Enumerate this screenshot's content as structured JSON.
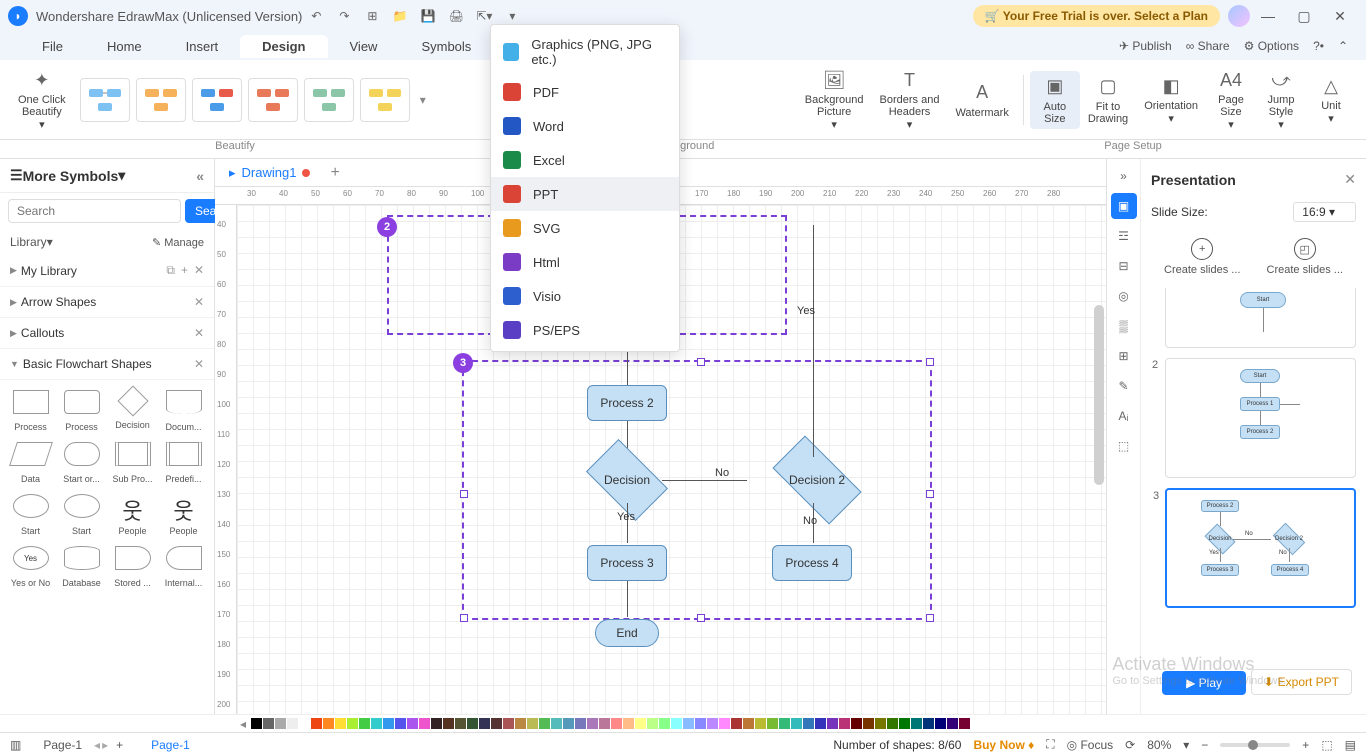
{
  "titlebar": {
    "app_name": "Wondershare EdrawMax (Unlicensed Version)",
    "trial": "🛒 Your Free Trial is over. Select a Plan"
  },
  "menu": {
    "items": [
      "File",
      "Home",
      "Insert",
      "Design",
      "View",
      "Symbols"
    ],
    "active": "Design",
    "right": {
      "publish": "Publish",
      "share": "Share",
      "options": "Options"
    }
  },
  "ribbon": {
    "one_click": "One Click\nBeautify",
    "beautify_label": "Beautify",
    "background_label": "Background",
    "pagesetup_label": "Page Setup",
    "btns": {
      "bgpic": "Background\nPicture",
      "borders": "Borders and\nHeaders",
      "watermark": "Watermark",
      "autosize": "Auto\nSize",
      "fit": "Fit to\nDrawing",
      "orient": "Orientation",
      "pagesize": "Page\nSize",
      "jump": "Jump\nStyle",
      "unit": "Unit"
    }
  },
  "export_menu": [
    {
      "label": "Graphics (PNG, JPG etc.)",
      "color": "#43b0e8"
    },
    {
      "label": "PDF",
      "color": "#d94436"
    },
    {
      "label": "Word",
      "color": "#2257c4"
    },
    {
      "label": "Excel",
      "color": "#1b8b4a"
    },
    {
      "label": "PPT",
      "color": "#d94436",
      "hover": true
    },
    {
      "label": "SVG",
      "color": "#e89a1f"
    },
    {
      "label": "Html",
      "color": "#7a3cc4"
    },
    {
      "label": "Visio",
      "color": "#2e5fcf"
    },
    {
      "label": "PS/EPS",
      "color": "#5a3fc4"
    }
  ],
  "sidebar": {
    "title": "More Symbols",
    "search_placeholder": "Search",
    "search_btn": "Search",
    "library": "Library",
    "manage": "✎ Manage",
    "mylib": "My Library",
    "cats": [
      "Arrow Shapes",
      "Callouts",
      "Basic Flowchart Shapes"
    ],
    "shapes": [
      "Process",
      "Process",
      "Decision",
      "Docum...",
      "Data",
      "Start or...",
      "Sub Pro...",
      "Predefi...",
      "Start",
      "Start",
      "People",
      "People",
      "Yes or No",
      "Database",
      "Stored ...",
      "Internal..."
    ]
  },
  "doc_tab": "Drawing1",
  "canvas": {
    "nodes": {
      "process2": "Process 2",
      "decision": "Decision",
      "decision2": "Decision 2",
      "process3": "Process 3",
      "process4": "Process 4",
      "end": "End"
    },
    "labels": {
      "yes": "Yes",
      "no": "No"
    },
    "badges": [
      "2",
      "3"
    ]
  },
  "rpanel": {
    "title": "Presentation",
    "slide_size_label": "Slide Size:",
    "slide_size_value": "16:9",
    "create1": "Create slides ...",
    "create2": "Create slides ...",
    "thumbs": [
      {
        "num": "",
        "items": [
          "Start"
        ],
        "sel": false,
        "partial": true
      },
      {
        "num": "2",
        "items": [
          "Start",
          "Process 1",
          "Process 2"
        ],
        "sel": false
      },
      {
        "num": "3",
        "items": [
          "Process 2",
          "Decision",
          "Decision 2",
          "Process 3",
          "Process 4"
        ],
        "sel": true
      }
    ],
    "play": "Play",
    "export": "Export PPT"
  },
  "colorbar_hues": [
    "#000",
    "#666",
    "#aaa",
    "#eee",
    "#fff",
    "#e41",
    "#f82",
    "#fd3",
    "#ae3",
    "#4c4",
    "#3cc",
    "#39e",
    "#55e",
    "#a5e",
    "#e5c",
    "#322",
    "#532",
    "#553",
    "#353",
    "#335",
    "#533",
    "#a55",
    "#b84",
    "#bb5",
    "#5b5",
    "#5bb",
    "#59b",
    "#77b",
    "#a7b",
    "#b79",
    "#f88",
    "#fb8",
    "#ff8",
    "#bf8",
    "#8f8",
    "#8ff",
    "#8bf",
    "#88f",
    "#b8f",
    "#f8f",
    "#a33",
    "#b73",
    "#bb3",
    "#7b3",
    "#3b7",
    "#3bb",
    "#37b",
    "#33b",
    "#73b",
    "#b37",
    "#600",
    "#730",
    "#770",
    "#370",
    "#070",
    "#077",
    "#037",
    "#007",
    "#307",
    "#703"
  ],
  "statusbar": {
    "page": "Page-1",
    "page_tab": "Page-1",
    "shapes": "Number of shapes: 8/60",
    "buy": "Buy Now",
    "focus": "Focus",
    "zoom": "80%"
  },
  "watermark": {
    "l1": "Activate Windows",
    "l2": "Go to Settings to activate Windows."
  }
}
